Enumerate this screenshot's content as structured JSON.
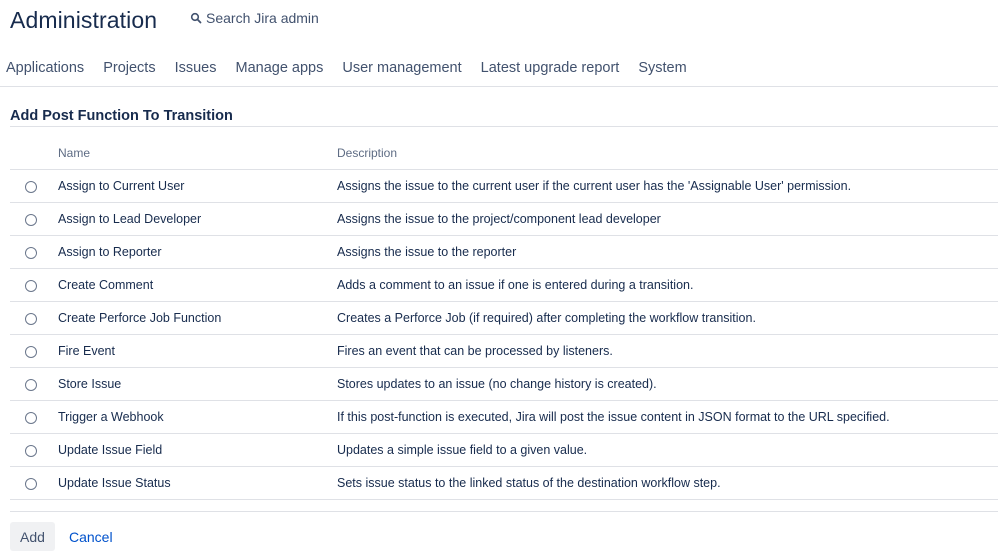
{
  "header": {
    "title": "Administration",
    "search_label": "Search Jira admin"
  },
  "nav": {
    "items": [
      {
        "label": "Applications"
      },
      {
        "label": "Projects"
      },
      {
        "label": "Issues"
      },
      {
        "label": "Manage apps"
      },
      {
        "label": "User management"
      },
      {
        "label": "Latest upgrade report"
      },
      {
        "label": "System"
      }
    ]
  },
  "page": {
    "section_title": "Add Post Function To Transition"
  },
  "table": {
    "columns": [
      "Name",
      "Description"
    ],
    "rows": [
      {
        "name": "Assign to Current User",
        "description": "Assigns the issue to the current user if the current user has the 'Assignable User' permission."
      },
      {
        "name": "Assign to Lead Developer",
        "description": "Assigns the issue to the project/component lead developer"
      },
      {
        "name": "Assign to Reporter",
        "description": "Assigns the issue to the reporter"
      },
      {
        "name": "Create Comment",
        "description": "Adds a comment to an issue if one is entered during a transition."
      },
      {
        "name": "Create Perforce Job Function",
        "description": "Creates a Perforce Job (if required) after completing the workflow transition."
      },
      {
        "name": "Fire Event",
        "description": "Fires an event that can be processed by listeners."
      },
      {
        "name": "Store Issue",
        "description": "Stores updates to an issue (no change history is created)."
      },
      {
        "name": "Trigger a Webhook",
        "description": "If this post-function is executed, Jira will post the issue content in JSON format to the URL specified."
      },
      {
        "name": "Update Issue Field",
        "description": "Updates a simple issue field to a given value."
      },
      {
        "name": "Update Issue Status",
        "description": "Sets issue status to the linked status of the destination workflow step."
      }
    ]
  },
  "actions": {
    "add_label": "Add",
    "cancel_label": "Cancel"
  },
  "colors": {
    "text": "#172b4d",
    "subtle": "#42526e",
    "link": "#0052cc",
    "border": "#dfe1e6"
  }
}
